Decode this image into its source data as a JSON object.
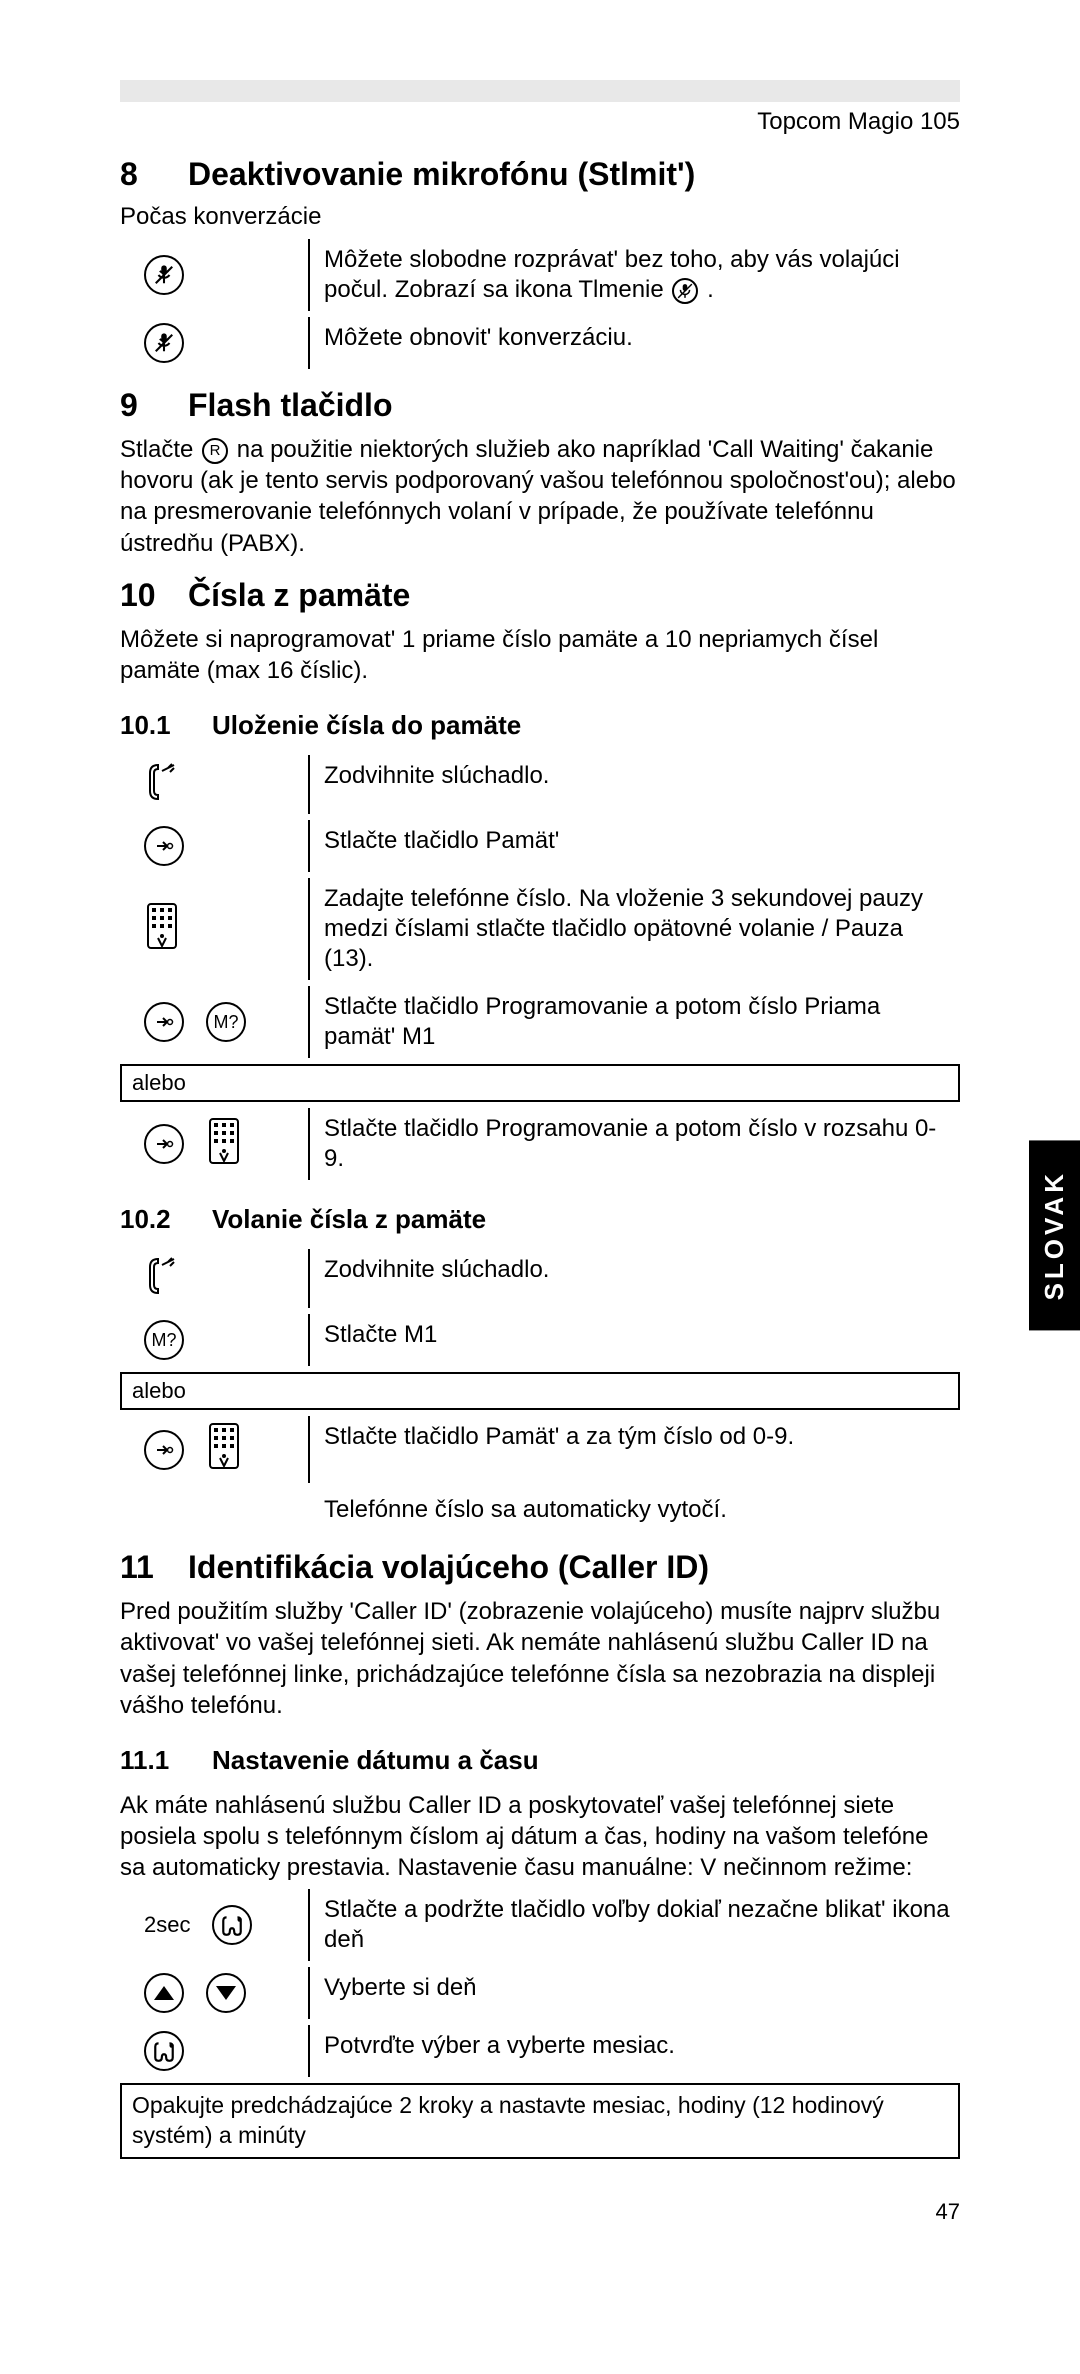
{
  "header": {
    "product": "Topcom Magio 105"
  },
  "section8": {
    "num": "8",
    "title": "Deaktivovanie mikrofónu (Stlmit')",
    "lead": "Počas konverzácie",
    "row1": "Môžete slobodne rozprávat' bez toho, aby vás volajúci počul. Zobrazí sa ikona Tlmenie",
    "row1_after": ".",
    "row2": "Môžete obnovit' konverzáciu."
  },
  "section9": {
    "num": "9",
    "title": "Flash tlačidlo",
    "body_before": "Stlačte",
    "body_after": "na použitie niektorých služieb ako napríklad 'Call Waiting' čakanie hovoru (ak je tento servis podporovaný vašou telefónnou spoločnost'ou); alebo na presmerovanie telefónnych volaní v prípade, že používate telefónnu ústredňu (PABX).",
    "r_label": "R"
  },
  "section10": {
    "num": "10",
    "title": "Čísla z pamäte",
    "body": "Môžete si naprogramovat' 1 priame číslo pamäte a 10 nepriamych čísel pamäte (max 16 číslic).",
    "sub1": {
      "num": "10.1",
      "title": "Uloženie čísla do pamäte"
    },
    "steps1": {
      "r1": "Zodvihnite slúchadlo.",
      "r2": "Stlačte tlačidlo Pamät'",
      "r3": "Zadajte telefónne číslo. Na vloženie 3 sekundovej pauzy medzi číslami stlačte tlačidlo opätovné volanie / Pauza (13).",
      "r4": "Stlačte tlačidlo Programovanie a potom číslo Priama pamät' M1",
      "m_label": "M?",
      "alebo": "alebo",
      "r5": "Stlačte tlačidlo Programovanie a potom číslo v rozsahu 0-9."
    },
    "sub2": {
      "num": "10.2",
      "title": "Volanie čísla z pamäte"
    },
    "steps2": {
      "r1": "Zodvihnite slúchadlo.",
      "r2": "Stlačte M1",
      "m_label": "M?",
      "alebo": "alebo",
      "r3": "Stlačte tlačidlo Pamät' a za tým číslo od 0-9.",
      "r4": "Telefónne číslo sa automaticky vytočí."
    }
  },
  "section11": {
    "num": "11",
    "title": "Identifikácia volajúceho (Caller ID)",
    "body": "Pred použitím služby 'Caller ID' (zobrazenie volajúceho) musíte najprv službu aktivovat' vo vašej telefónnej sieti. Ak nemáte nahlásenú službu Caller ID na vašej telefónnej linke, prichádzajúce telefónne čísla sa nezobrazia na displeji vášho telefónu.",
    "sub1": {
      "num": "11.1",
      "title": "Nastavenie dátumu a času"
    },
    "body2": "Ak máte nahlásenú službu Caller ID a poskytovateľ vašej telefónnej siete posiela spolu s telefónnym číslom aj dátum a čas, hodiny na vašom telefóne sa automaticky prestavia. Nastavenie času manuálne: V nečinnom režime:",
    "steps": {
      "sec_label": "2sec",
      "r1": "Stlačte a podržte tlačidlo voľby dokiaľ nezačne blikat' ikona deň",
      "r2": "Vyberte si deň",
      "r3": "Potvrďte výber a vyberte mesiac.",
      "note": "Opakujte predchádzajúce 2 kroky a nastavte mesiac, hodiny (12 hodinový systém) a minúty"
    }
  },
  "sidetab": "SLOVAK",
  "pagenum": "47"
}
